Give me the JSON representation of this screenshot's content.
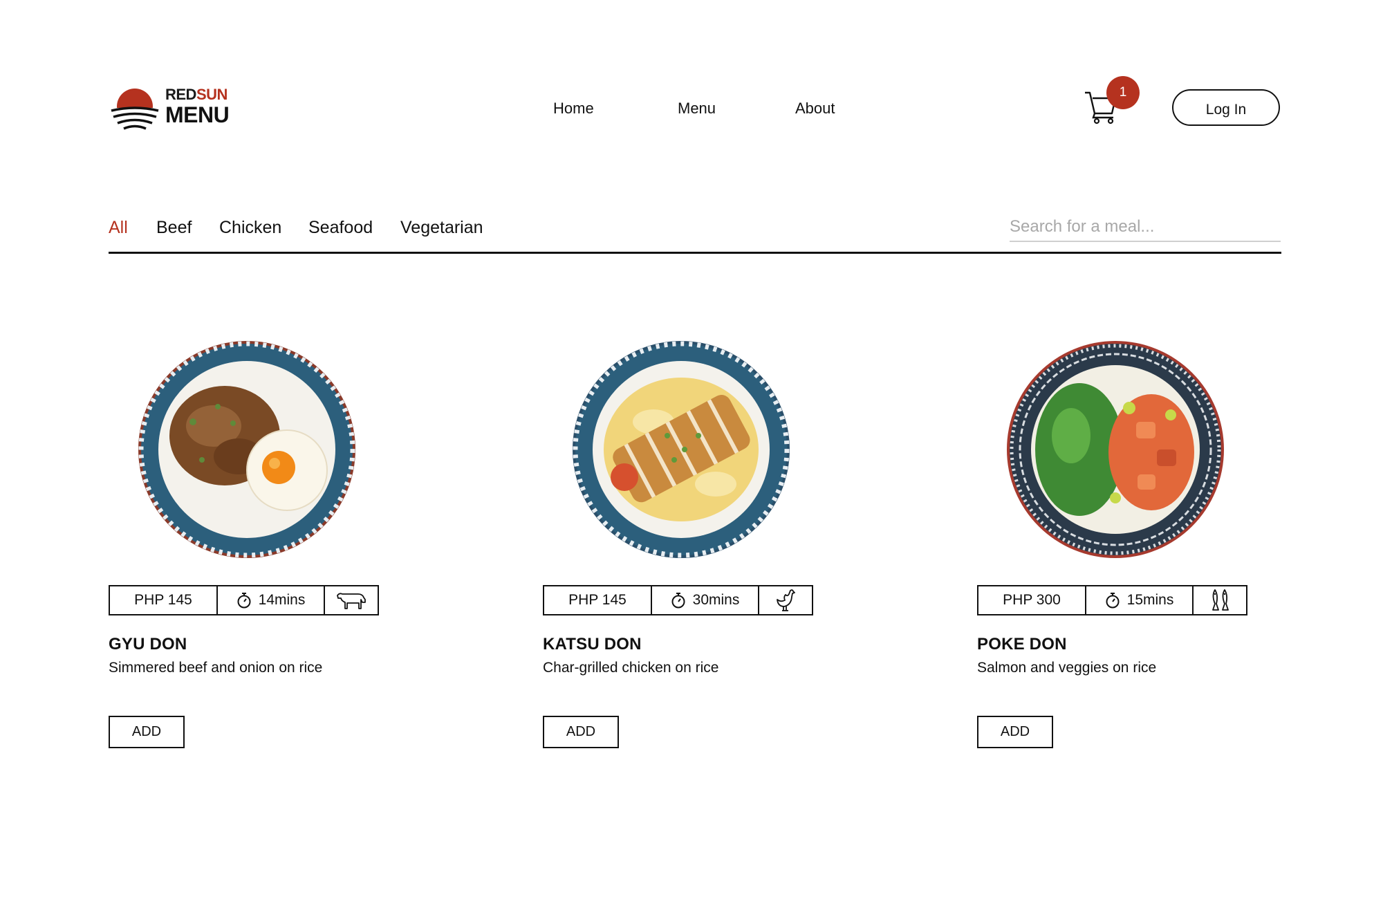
{
  "header": {
    "logo": {
      "line1_a": "RED",
      "line1_b": "SUN",
      "line2": "MENU"
    },
    "nav": {
      "home": "Home",
      "menu": "Menu",
      "about": "About"
    },
    "cart_count": "1",
    "login_label": "Log In"
  },
  "filters": {
    "categories": [
      "All",
      "Beef",
      "Chicken",
      "Seafood",
      "Vegetarian"
    ],
    "active": "All",
    "search_placeholder": "Search for a meal..."
  },
  "dishes": [
    {
      "price": "PHP 145",
      "time": "14mins",
      "type_icon": "cow-icon",
      "name": "GYU DON",
      "description": "Simmered beef and onion on rice",
      "add_label": "ADD"
    },
    {
      "price": "PHP 145",
      "time": "30mins",
      "type_icon": "chicken-icon",
      "name": "KATSU DON",
      "description": "Char-grilled chicken on rice",
      "add_label": "ADD"
    },
    {
      "price": "PHP 300",
      "time": "15mins",
      "type_icon": "fish-icon",
      "name": "POKE DON",
      "description": "Salmon and veggies on rice",
      "add_label": "ADD"
    }
  ],
  "colors": {
    "accent": "#b5321f",
    "text": "#111111",
    "bowl_blue": "#2c5f7c",
    "rice": "#f4f2ec"
  }
}
